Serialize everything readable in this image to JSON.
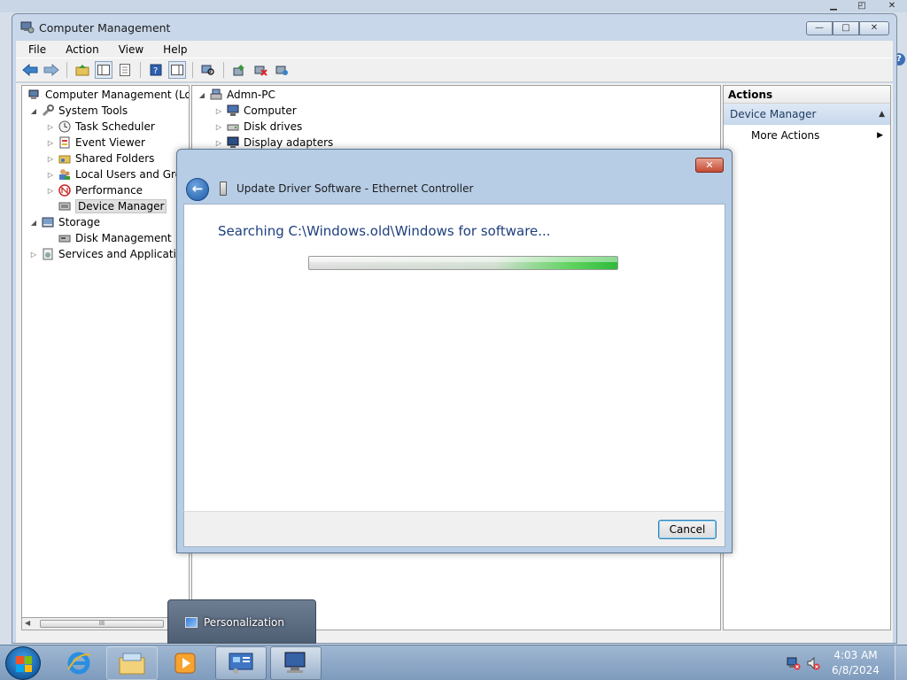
{
  "main_window": {
    "title": "Computer Management",
    "controls": {
      "minimize": "—",
      "maximize": "□",
      "close": "✕"
    }
  },
  "menu": [
    "File",
    "Action",
    "View",
    "Help"
  ],
  "tree": [
    {
      "label": "Computer Management (Local",
      "icon": "computer-management-icon",
      "expander": "",
      "indent": 0
    },
    {
      "label": "System Tools",
      "icon": "system-tools-icon",
      "expander": "◢",
      "indent": 1
    },
    {
      "label": "Task Scheduler",
      "icon": "task-scheduler-icon",
      "expander": "▷",
      "indent": 2
    },
    {
      "label": "Event Viewer",
      "icon": "event-viewer-icon",
      "expander": "▷",
      "indent": 2
    },
    {
      "label": "Shared Folders",
      "icon": "shared-folders-icon",
      "expander": "▷",
      "indent": 2
    },
    {
      "label": "Local Users and Group",
      "icon": "local-users-icon",
      "expander": "▷",
      "indent": 2
    },
    {
      "label": "Performance",
      "icon": "performance-icon",
      "expander": "▷",
      "indent": 2
    },
    {
      "label": "Device Manager",
      "icon": "device-manager-icon",
      "expander": "",
      "indent": 2,
      "selected": true
    },
    {
      "label": "Storage",
      "icon": "storage-icon",
      "expander": "◢",
      "indent": 1
    },
    {
      "label": "Disk Management",
      "icon": "disk-management-icon",
      "expander": "",
      "indent": 2
    },
    {
      "label": "Services and Applications",
      "icon": "services-icon",
      "expander": "▷",
      "indent": 1
    }
  ],
  "scroll_grip": "III",
  "device_tree": [
    {
      "label": "Admn-PC",
      "expander": "◢",
      "indent": 0
    },
    {
      "label": "Computer",
      "expander": "▷",
      "indent": 1
    },
    {
      "label": "Disk drives",
      "expander": "▷",
      "indent": 1
    },
    {
      "label": "Display adapters",
      "expander": "▷",
      "indent": 1
    }
  ],
  "actions": {
    "header": "Actions",
    "section": "Device Manager",
    "section_tri": "▲",
    "more": "More Actions",
    "more_tri": "▶"
  },
  "dialog": {
    "close": "✕",
    "back": "←",
    "title": "Update Driver Software - Ethernet Controller",
    "heading": "Searching C:\\Windows.old\\Windows for software...",
    "cancel": "Cancel",
    "progress_indeterminate": true
  },
  "taskbar": {
    "apps": [
      {
        "name": "internet-explorer-icon",
        "state": "plain"
      },
      {
        "name": "windows-explorer-icon",
        "state": "pinned"
      },
      {
        "name": "media-player-icon",
        "state": "plain"
      },
      {
        "name": "control-panel-icon",
        "state": "active"
      },
      {
        "name": "computer-management-taskbar-icon",
        "state": "active"
      }
    ],
    "time": "4:03 AM",
    "date": "6/8/2024"
  },
  "thumbnail_popup": {
    "label": "Personalization"
  },
  "colors": {
    "accent": "#1e3f7e",
    "progress": "#2fbb3a",
    "close_red": "#c44b33"
  }
}
